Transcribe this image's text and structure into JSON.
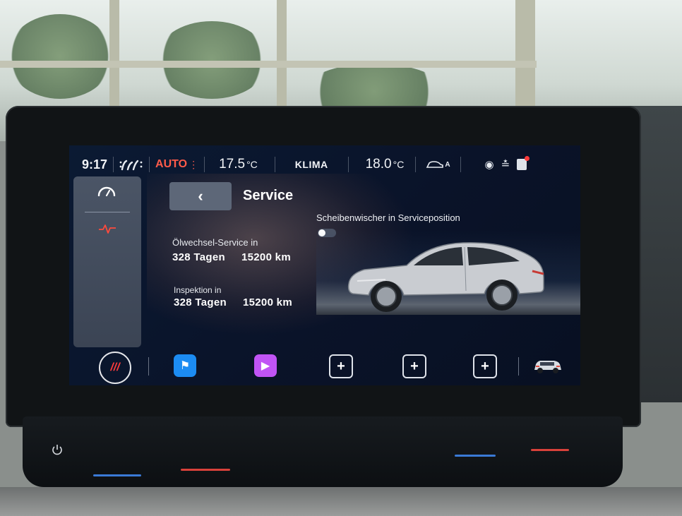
{
  "status_bar": {
    "time": "9:17",
    "seat_icon": "seat-heating-icon",
    "auto_label": "AUTO",
    "temp_left_value": "17.5",
    "temp_left_unit": "°C",
    "klima_label": "KLIMA",
    "temp_right_value": "18.0",
    "temp_right_unit": "°C",
    "fan_label": "A",
    "accent_color": "#ff5b4a"
  },
  "sidebar": {
    "items": [
      {
        "icon": "gauge-icon"
      },
      {
        "icon": "pulse-icon",
        "color": "#ff3b3b"
      }
    ]
  },
  "header": {
    "back_icon": "‹",
    "title": "Service"
  },
  "service": {
    "oil_label": "Ölwechsel-Service in",
    "oil_days": "328 Tagen",
    "oil_km": "15200 km",
    "inspection_label": "Inspektion in",
    "inspection_days": "328 Tagen",
    "inspection_km": "15200 km"
  },
  "wiper": {
    "label": "Scheibenwischer in Serviceposition",
    "enabled": false
  },
  "dock": {
    "red_label": "///",
    "flag_icon": "flag-icon",
    "play_icon": "play-icon",
    "plus_label": "+",
    "car_icon": "car-icon"
  }
}
